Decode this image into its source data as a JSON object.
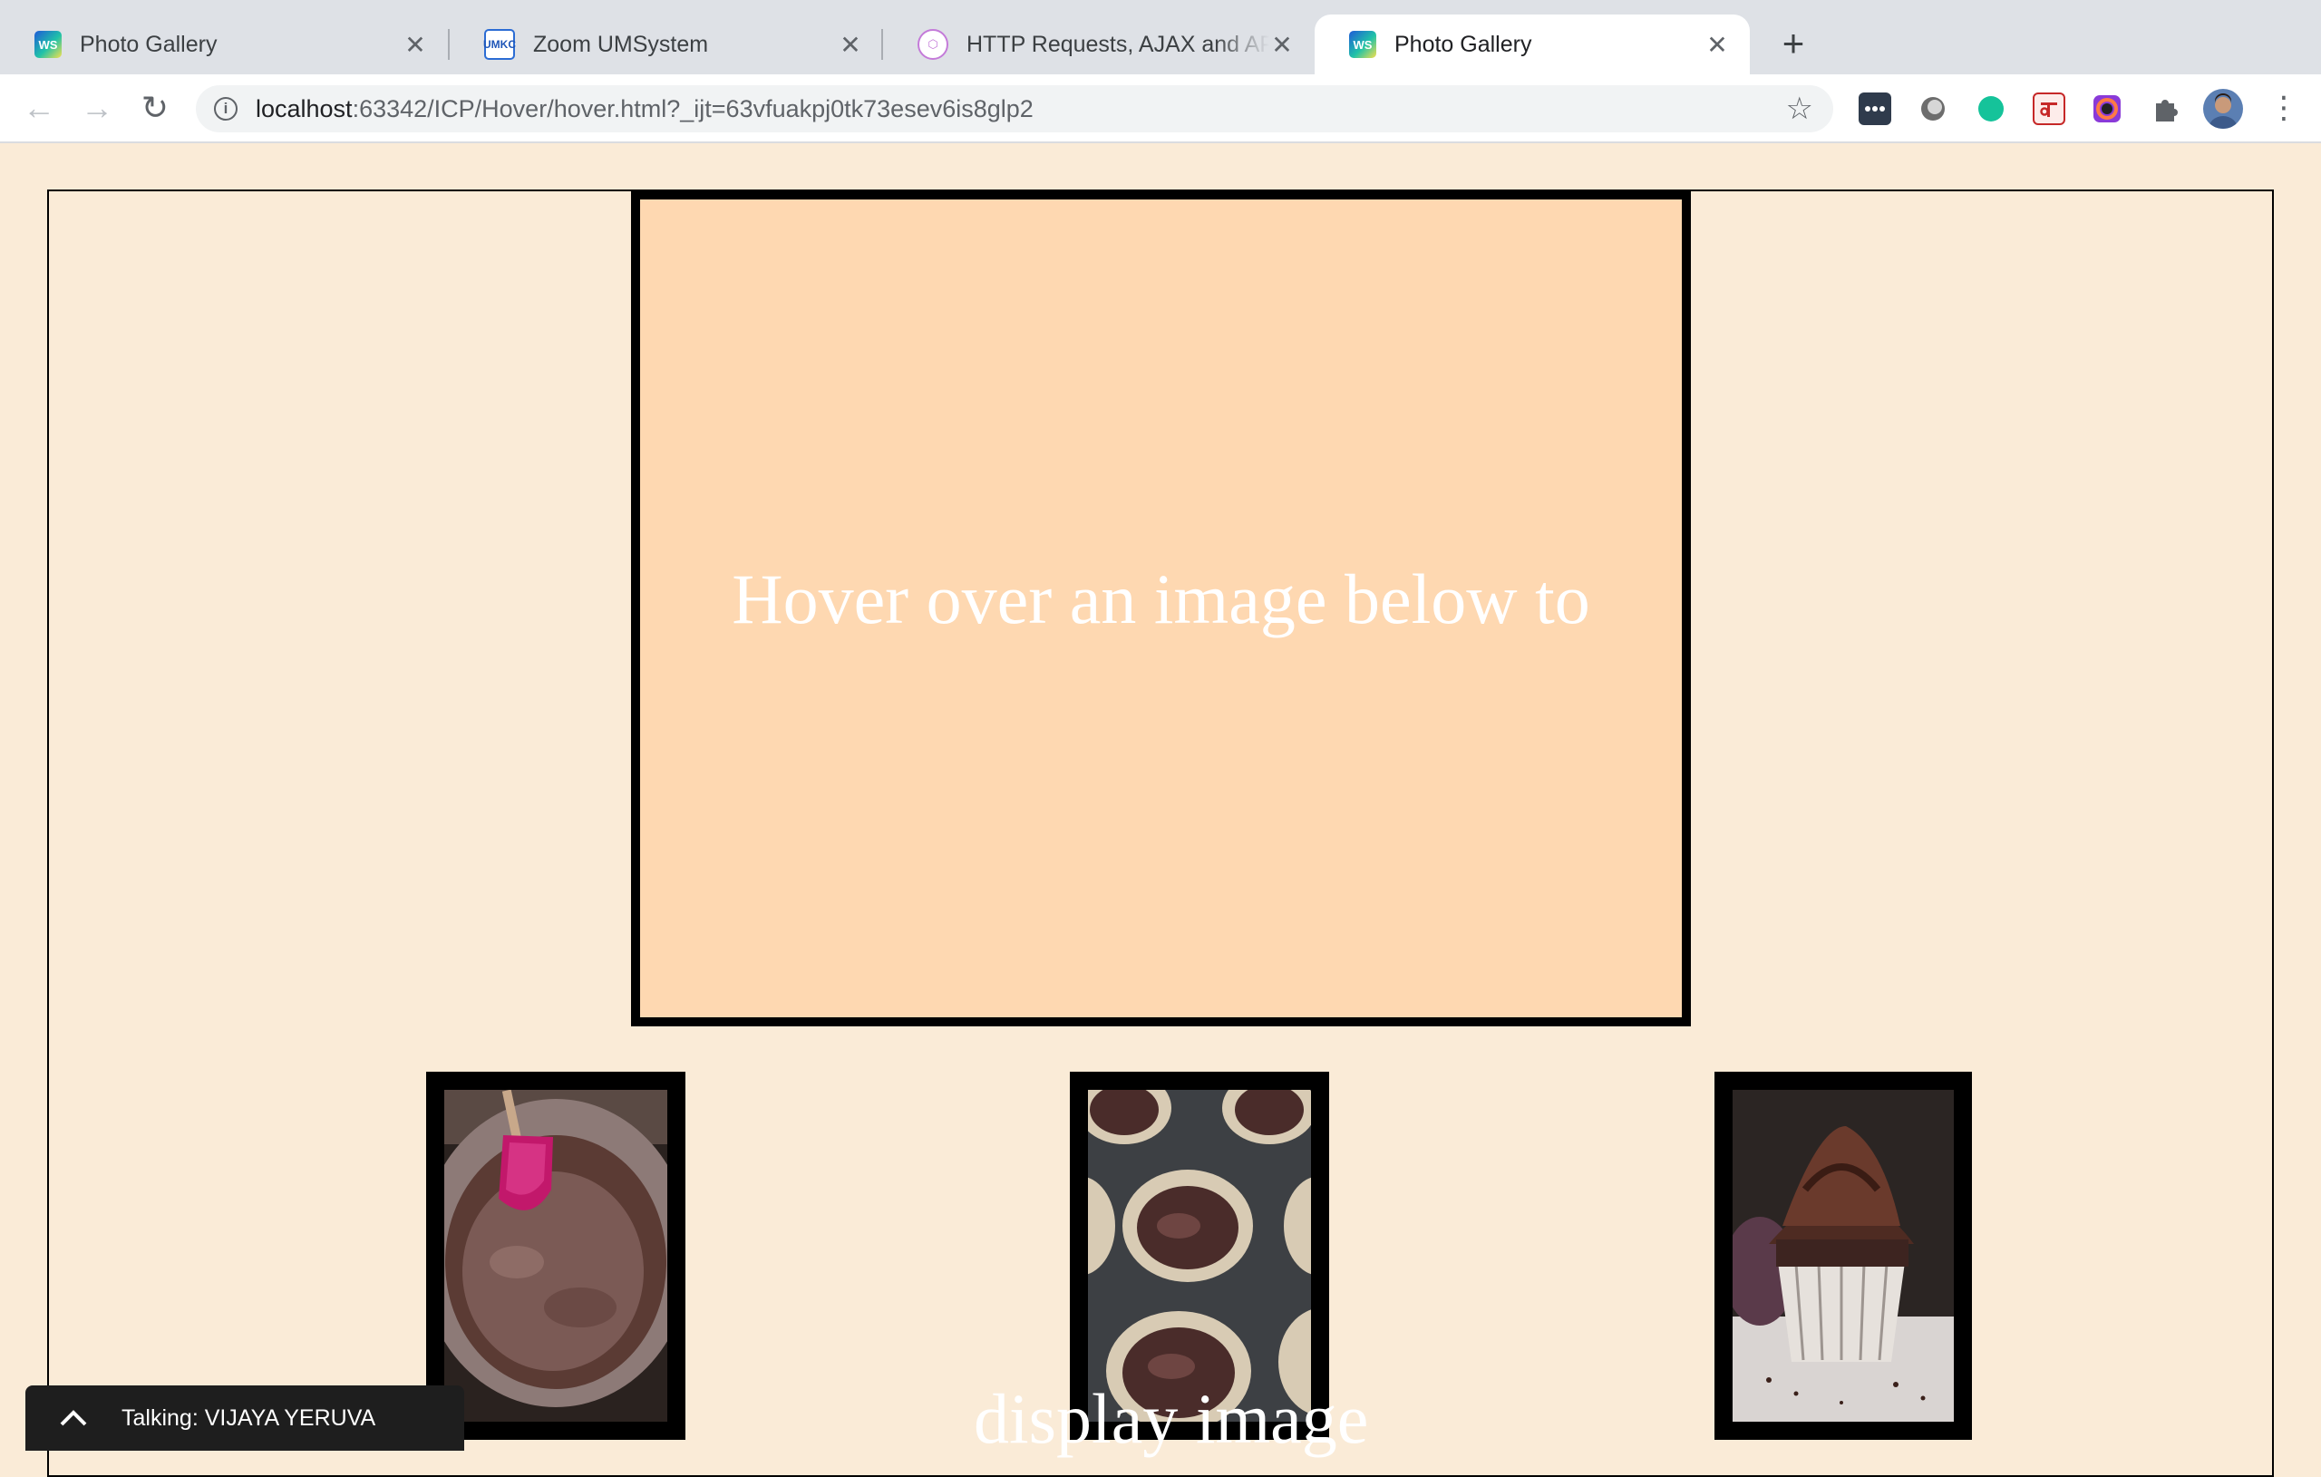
{
  "browser": {
    "tabs": [
      {
        "title": "Photo Gallery",
        "icon": "webstorm-icon",
        "active": false
      },
      {
        "title": "Zoom UMSystem",
        "icon": "umkc-icon",
        "active": false
      },
      {
        "title": "HTTP Requests, AJAX and API",
        "icon": "graph-icon",
        "active": false
      },
      {
        "title": "Photo Gallery",
        "icon": "webstorm-icon",
        "active": true
      }
    ],
    "favicon_text": {
      "ws": "WS",
      "umkc": "UMKC",
      "graph": "⬡"
    },
    "new_tab_label": "+",
    "close_glyph": "✕",
    "url_host": "localhost",
    "url_rest": ":63342/ICP/Hover/hover.html?_ijt=63vfuakpj0tk73esev6is8glp2",
    "info_glyph": "i",
    "star_glyph": "☆",
    "nav_glyphs": {
      "back": "←",
      "forward": "→",
      "reload": "↻",
      "menu": "⋮"
    },
    "extensions": [
      "dots-icon",
      "circle-icon",
      "grammarly-icon",
      "hindi-ka-icon",
      "color-ring-icon",
      "puzzle-icon",
      "profile-avatar"
    ]
  },
  "page": {
    "background": "#faebd7",
    "preview_background": "#fed8b1",
    "preview_text": "Hover over an image below to",
    "caption_overlay": "display image",
    "thumbnails": [
      {
        "name": "chocolate-batter-bowl",
        "alt": "batter bowl"
      },
      {
        "name": "cupcake-tin-batter",
        "alt": "cupcake tin"
      },
      {
        "name": "frosted-chocolate-cupcake",
        "alt": "frosted cupcake"
      }
    ]
  },
  "zoom": {
    "talking_label": "Talking: VIJAYA YERUVA"
  }
}
